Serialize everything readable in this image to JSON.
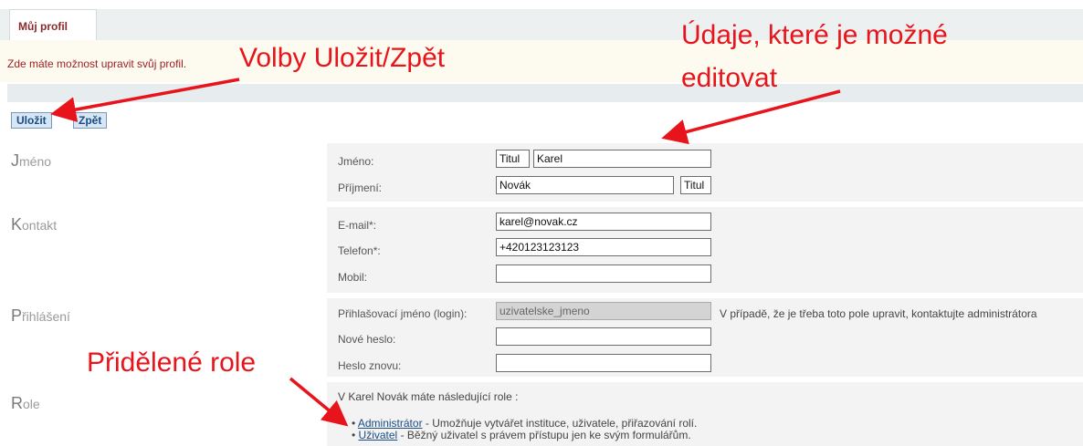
{
  "tabs": {
    "active": "Můj profil"
  },
  "intro_text": "Zde máte možnost upravit svůj profil.",
  "toolbar": {
    "save_label": "Uložit",
    "back_label": "Zpět"
  },
  "sections": {
    "name": {
      "title_initial": "J",
      "title_rest": "méno",
      "first_name_label": "Jméno:",
      "first_name_value": "Karel",
      "title_before_value": "Titul",
      "last_name_label": "Příjmení:",
      "last_name_value": "Novák",
      "title_after_value": "Titul"
    },
    "contact": {
      "title_initial": "K",
      "title_rest": "ontakt",
      "email_label": "E-mail*:",
      "email_value": "karel@novak.cz",
      "phone_label": "Telefon*:",
      "phone_value": "+420123123123",
      "mobile_label": "Mobil:",
      "mobile_value": ""
    },
    "login": {
      "title_initial": "P",
      "title_rest": "řihlášení",
      "login_label": "Přihlašovací jméno (login):",
      "login_value": "uzivatelske_jmeno",
      "login_note": "V případě, že je třeba toto pole upravit, kontaktujte administrátora",
      "new_password_label": "Nové heslo:",
      "new_password_value": "",
      "repeat_password_label": "Heslo znovu:",
      "repeat_password_value": ""
    },
    "roles": {
      "title_initial": "R",
      "title_rest": "ole",
      "intro": "V Karel Novák máte následující role :",
      "items": [
        {
          "name": "Administrátor",
          "description": " - Umožňuje vytvářet instituce, uživatele, přiřazování rolí."
        },
        {
          "name": "Uživatel",
          "description": " - Běžný uživatel s právem přístupu jen ke svým formulářům."
        }
      ]
    }
  },
  "annotations": {
    "buttons": "Volby Uložit/Zpět",
    "editable_line1": "Údaje, které je možné",
    "editable_line2": "editovat",
    "roles": "Přidělené role"
  },
  "colors": {
    "annotation": "#e8141b",
    "link": "#1b4c84",
    "tab_text": "#8a2b2b"
  }
}
